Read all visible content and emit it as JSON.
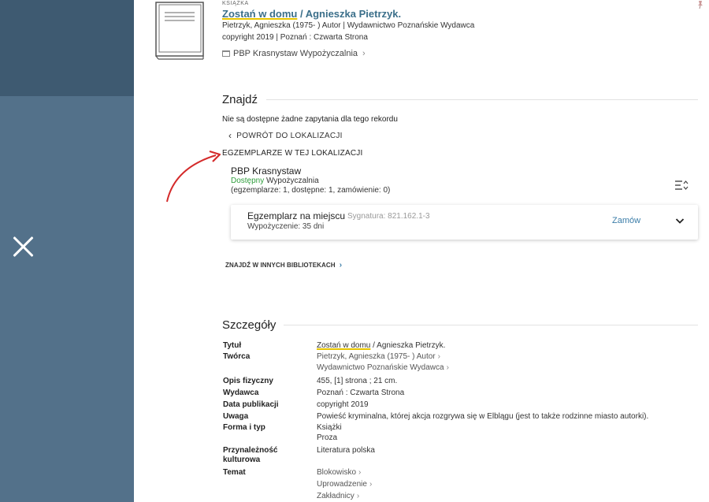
{
  "record": {
    "type_label": "KSIĄŻKA",
    "title_highlight": "Zostań w domu",
    "title_rest": " / Agnieszka Pietrzyk.",
    "author_line": "Pietrzyk, Agnieszka (1975- ) Autor | Wydawnictwo Poznańskie Wydawca",
    "pub_line": "copyright 2019 | Poznań : Czwarta Strona",
    "location_link": "PBP Krasnystaw  Wypożyczalnia"
  },
  "find": {
    "title": "Znajdź",
    "no_query": "Nie są dostępne żadne zapytania dla tego rekordu",
    "back_label": "POWRÓT DO LOKALIZACJI",
    "copies_heading": "EGZEMPLARZE W TEJ LOKALIZACJI",
    "library": {
      "name": "PBP Krasnystaw",
      "status": "Dostępny",
      "location": " Wypożyczalnia",
      "counts": "(egzemplarze: 1, dostępne: 1, zamówienie: 0)"
    },
    "copy": {
      "type": "Egzemplarz na miejscu",
      "signature": "Sygnatura: 821.162.1-3",
      "loan": "Wypożyczenie: 35 dni",
      "order_label": "Zamów"
    },
    "other_libraries": "ZNAJDŹ W INNYCH BIBLIOTEKACH"
  },
  "details": {
    "title": "Szczegóły",
    "title_label": "Tytuł",
    "title_value_highlight": "Zostań w domu",
    "title_value_rest": " / Agnieszka Pietrzyk.",
    "creator_label": "Twórca",
    "creators": [
      "Pietrzyk, Agnieszka (1975- ) Autor",
      "Wydawnictwo Poznańskie Wydawca"
    ],
    "physical_label": "Opis fizyczny",
    "physical_value": "455, [1] strona ; 21 cm.",
    "publisher_label": "Wydawca",
    "publisher_value": "Poznań : Czwarta Strona",
    "date_label": "Data publikacji",
    "date_value": "copyright 2019",
    "note_label": "Uwaga",
    "note_value": "Powieść kryminalna, której akcja rozgrywa się w Elblągu (jest to także rodzinne miasto autorki).",
    "form_label": "Forma i typ",
    "forms": [
      "Książki",
      "Proza"
    ],
    "culture_label": "Przynależność kulturowa",
    "culture_value": "Literatura polska",
    "subject_label": "Temat",
    "subjects": [
      "Blokowisko",
      "Uprowadzenie",
      "Zakładnicy"
    ]
  },
  "icons": {
    "close": "close-icon",
    "book": "book-icon",
    "pin": "pin-icon",
    "sort": "sort-icon",
    "expand": "chevron-down-icon"
  },
  "colors": {
    "panel": "#53718a",
    "panel_top": "#3e5a71",
    "link": "#3b7da8",
    "available": "#2f9d3c",
    "highlight": "#e6c400",
    "annotation_arrow": "#d42a2a"
  }
}
